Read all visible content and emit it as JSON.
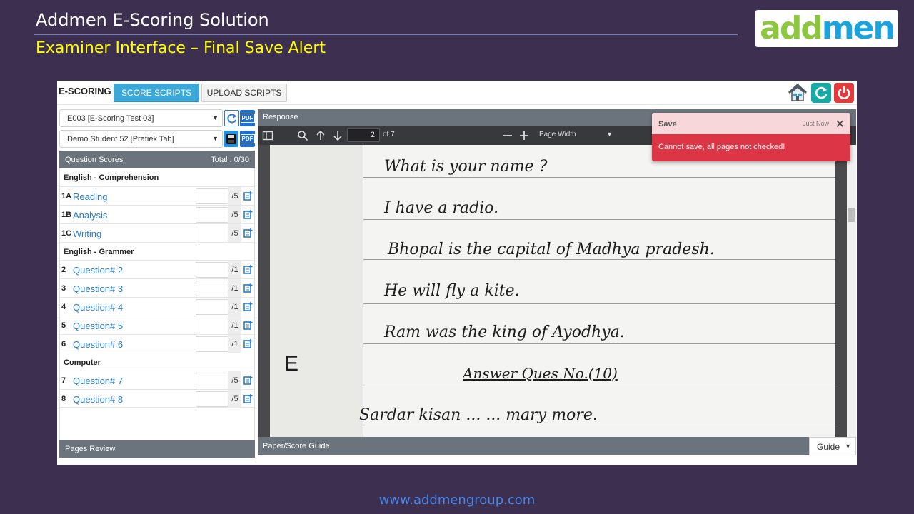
{
  "slide": {
    "title": "Addmen E-Scoring Solution",
    "subtitle": "Examiner Interface – Final Save Alert",
    "logo_part1": "add",
    "logo_part2": "men",
    "footer_url": "www.addmengroup.com"
  },
  "topbar": {
    "brand": "E-SCORING",
    "tab_score": "SCORE SCRIPTS",
    "tab_upload": "UPLOAD SCRIPTS"
  },
  "left": {
    "exam_select": "E003 [E-Scoring Test 03]",
    "student_select": "Demo Student 52 [Pratiek Tab]",
    "pdf_label": "PDF",
    "qs_title": "Question Scores",
    "qs_total": "Total : 0/30",
    "sections": [
      {
        "name": "English - Comprehension",
        "rows": [
          {
            "num": "1A",
            "name": "Reading",
            "max": "/5"
          },
          {
            "num": "1B",
            "name": "Analysis",
            "max": "/5"
          },
          {
            "num": "1C",
            "name": "Writing",
            "max": "/5"
          }
        ]
      },
      {
        "name": "English - Grammer",
        "rows": [
          {
            "num": "2",
            "name": "Question# 2",
            "max": "/1"
          },
          {
            "num": "3",
            "name": "Question# 3",
            "max": "/1"
          },
          {
            "num": "4",
            "name": "Question# 4",
            "max": "/1"
          },
          {
            "num": "5",
            "name": "Question# 5",
            "max": "/1"
          },
          {
            "num": "6",
            "name": "Question# 6",
            "max": "/1"
          }
        ]
      },
      {
        "name": "Computer",
        "rows": [
          {
            "num": "7",
            "name": "Question# 7",
            "max": "/5"
          },
          {
            "num": "8",
            "name": "Question# 8",
            "max": "/5"
          }
        ]
      }
    ],
    "pages_review": "Pages Review"
  },
  "viewer": {
    "response_title": "Response",
    "page_current": "2",
    "page_of": "of 7",
    "zoom": "Page Width",
    "handwriting": [
      "What is your name ?",
      "I have a radio.",
      "Bhopal is the capital of Madhya pradesh.",
      "He will fly a kite.",
      "Ram was the king of Ayodhya.",
      "Answer Ques No.(10)",
      "Sardar kisan ... ... mary more."
    ],
    "margin_letter": "E",
    "score_guide": "Paper/Score Guide",
    "guide_select": "Guide"
  },
  "toast": {
    "title": "Save",
    "time": "Just Now",
    "close": "✕",
    "message": "Cannot save, all pages not checked!"
  },
  "colors": {
    "background": "#3d2f50",
    "primary_tab": "#3ca8d8",
    "panel_header": "#6b747d",
    "toast_head": "#f8d7da",
    "toast_body": "#dc3545",
    "link": "#2a7cc7"
  }
}
